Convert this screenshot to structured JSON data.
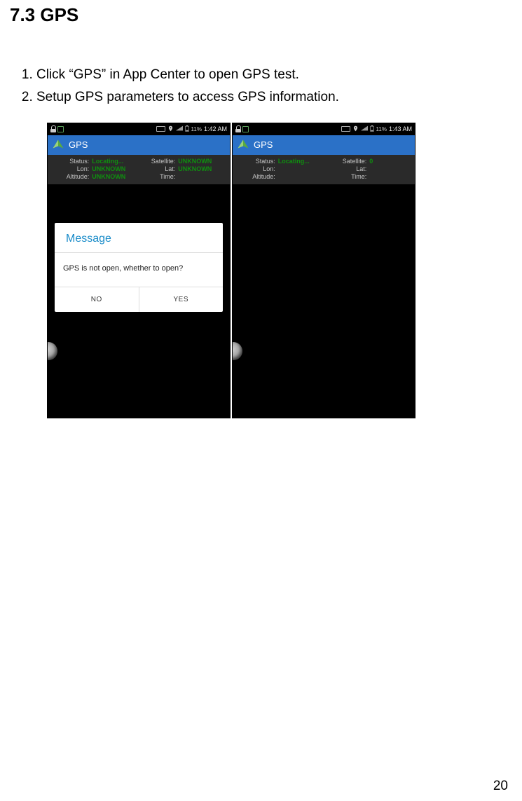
{
  "section": {
    "heading": "7.3 GPS"
  },
  "steps": [
    "Click “GPS” in App Center to open GPS test.",
    "Setup GPS parameters to access GPS information."
  ],
  "shot1": {
    "statusbar": {
      "battery_pct": "11%",
      "clock": "1:42 AM"
    },
    "appbar": {
      "title": "GPS"
    },
    "info": {
      "status_lbl": "Status:",
      "status_val": "Locating...",
      "lon_lbl": "Lon:",
      "lon_val": "UNKNOWN",
      "alt_lbl": "Altitude:",
      "alt_val": "UNKNOWN",
      "sat_lbl": "Satellite:",
      "sat_val": "UNKNOWN",
      "lat_lbl": "Lat:",
      "lat_val": "UNKNOWN",
      "time_lbl": "Time:",
      "time_val": ""
    },
    "dialog": {
      "title": "Message",
      "body": "GPS is not open, whether to open?",
      "no": "NO",
      "yes": "YES"
    }
  },
  "shot2": {
    "statusbar": {
      "battery_pct": "11%",
      "clock": "1:43 AM"
    },
    "appbar": {
      "title": "GPS"
    },
    "info": {
      "status_lbl": "Status:",
      "status_val": "Locating...",
      "lon_lbl": "Lon:",
      "lon_val": "",
      "alt_lbl": "Altitude:",
      "alt_val": "",
      "sat_lbl": "Satellite:",
      "sat_val": "0",
      "lat_lbl": "Lat:",
      "lat_val": "",
      "time_lbl": "Time:",
      "time_val": ""
    }
  },
  "page_number": "20"
}
